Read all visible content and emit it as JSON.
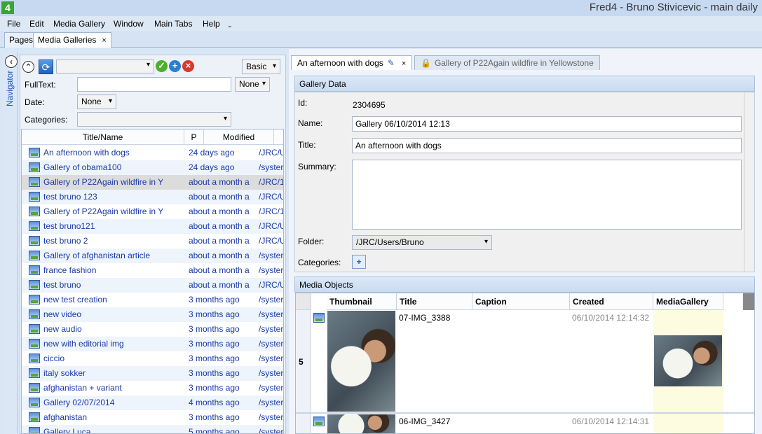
{
  "window": {
    "logo": "4",
    "title": "Fred4 - Bruno Stivicevic - main daily"
  },
  "menu": [
    "File",
    "Edit",
    "Media Gallery",
    "Window",
    "Main Tabs",
    "Help"
  ],
  "main_tabs": [
    {
      "label": "Pages"
    },
    {
      "label": "Media Galleries"
    }
  ],
  "navigator": {
    "label": "Navigator"
  },
  "filters": {
    "mode": "Basic",
    "fulltext_label": "FullText:",
    "fulltext_option": "None",
    "date_label": "Date:",
    "date_value": "None",
    "categories_label": "Categories:"
  },
  "list": {
    "headers": [
      "Title/Name",
      "P",
      "Modified"
    ],
    "rows": [
      {
        "title": "An afternoon with dogs",
        "modified": "24 days ago",
        "path": "/JRC/U"
      },
      {
        "title": "Gallery of obama100",
        "modified": "24 days ago",
        "path": "/syster"
      },
      {
        "title": "Gallery of P22Again wildfire in Y",
        "modified": "about a month a",
        "path": "/JRC/1"
      },
      {
        "title": "test bruno 123",
        "modified": "about a month a",
        "path": "/JRC/U"
      },
      {
        "title": "Gallery of P22Again wildfire in Y",
        "modified": "about a month a",
        "path": "/JRC/1"
      },
      {
        "title": "test bruno121",
        "modified": "about a month a",
        "path": "/JRC/U"
      },
      {
        "title": "test bruno 2",
        "modified": "about a month a",
        "path": "/JRC/U"
      },
      {
        "title": "Gallery of afghanistan article",
        "modified": "about a month a",
        "path": "/syster"
      },
      {
        "title": "france fashion",
        "modified": "about a month a",
        "path": "/syster"
      },
      {
        "title": "test bruno",
        "modified": "about a month a",
        "path": "/JRC/U"
      },
      {
        "title": "new test creation",
        "modified": "3 months ago",
        "path": "/syster"
      },
      {
        "title": "new video",
        "modified": "3 months ago",
        "path": "/syster"
      },
      {
        "title": "new audio",
        "modified": "3 months ago",
        "path": "/syster"
      },
      {
        "title": "new with editorial img",
        "modified": "3 months ago",
        "path": "/syster"
      },
      {
        "title": "ciccio",
        "modified": "3 months ago",
        "path": "/syster"
      },
      {
        "title": "italy sokker",
        "modified": "3 months ago",
        "path": "/syster"
      },
      {
        "title": "afghanistan + variant",
        "modified": "3 months ago",
        "path": "/syster"
      },
      {
        "title": "Gallery 02/07/2014",
        "modified": "4 months ago",
        "path": "/syster"
      },
      {
        "title": "afghanistan",
        "modified": "3 months ago",
        "path": "/syster"
      },
      {
        "title": "Gallery Luca",
        "modified": "5 months ago",
        "path": "/syster"
      }
    ]
  },
  "editor_tabs": [
    {
      "label": "An afternoon with dogs"
    },
    {
      "label": "Gallery of P22Again wildfire in Yellowstone"
    }
  ],
  "gallery_data": {
    "header": "Gallery Data",
    "id_label": "Id:",
    "id_value": "2304695",
    "name_label": "Name:",
    "name_value": "Gallery 06/10/2014 12:13",
    "title_label": "Title:",
    "title_value": "An afternoon with dogs",
    "summary_label": "Summary:",
    "summary_value": "",
    "folder_label": "Folder:",
    "folder_value": "/JRC/Users/Bruno",
    "categories_label": "Categories:"
  },
  "media_objects": {
    "header": "Media Objects",
    "columns": [
      "Thumbnail",
      "Title",
      "Caption",
      "Created",
      "MediaGallery"
    ],
    "rows": [
      {
        "index": "5",
        "title": "07-IMG_3388",
        "caption": "",
        "created": "06/10/2014 12:14:32"
      },
      {
        "index": "",
        "title": "06-IMG_3427",
        "caption": "",
        "created": "06/10/2014 12:14:31"
      }
    ]
  },
  "colors": {
    "accent": "#1a3aa8",
    "selection": "#dcdcdc",
    "gallery_cell": "#fdfbe0"
  }
}
